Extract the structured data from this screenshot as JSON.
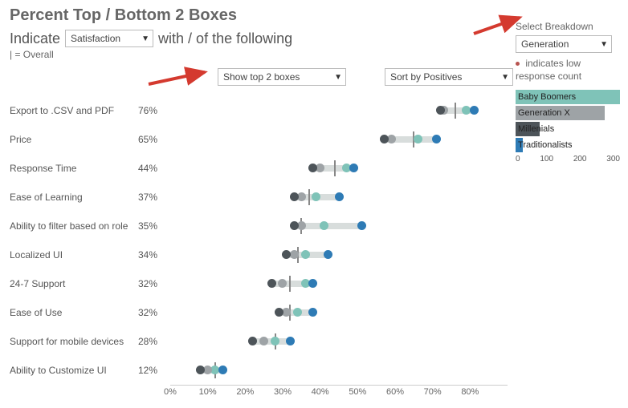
{
  "title": "Percent Top / Bottom 2 Boxes",
  "indicate": {
    "prefix": "Indicate",
    "dropdown_value": "Satisfaction",
    "suffix": "with / of the following",
    "overall_note": "| = Overall"
  },
  "controls": {
    "show_boxes": "Show top 2 boxes",
    "sort_by": "Sort by Positives"
  },
  "breakdown": {
    "label": "Select Breakdown",
    "value": "Generation"
  },
  "legend_note": {
    "prefix_symbol": "•",
    "text": "indicates low response count"
  },
  "colors": {
    "baby_boomers": "#7fc3b8",
    "generation_x": "#9ea3a6",
    "millenials": "#4d5459",
    "traditionalists": "#2e7bb5"
  },
  "mini_legend": {
    "axis": [
      "0",
      "100",
      "200",
      "300"
    ],
    "items": [
      {
        "label": "Baby Boomers",
        "color_key": "baby_boomers",
        "value": 300
      },
      {
        "label": "Generation X",
        "color_key": "generation_x",
        "value": 255
      },
      {
        "label": "Millenials",
        "color_key": "millenials",
        "value": 70
      },
      {
        "label": "Traditionalists",
        "color_key": "traditionalists",
        "value": 20
      }
    ],
    "max": 300
  },
  "chart_data": {
    "type": "dot-strip",
    "xlabel": "",
    "xlim": [
      0,
      90
    ],
    "axis_ticks": [
      "0%",
      "10%",
      "20%",
      "30%",
      "40%",
      "50%",
      "60%",
      "70%",
      "80%"
    ],
    "series": [
      {
        "name": "Baby Boomers",
        "color_key": "baby_boomers"
      },
      {
        "name": "Generation X",
        "color_key": "generation_x"
      },
      {
        "name": "Millenials",
        "color_key": "millenials"
      },
      {
        "name": "Overall (tick)",
        "color_key": "overall_tick"
      },
      {
        "name": "Traditionalists",
        "color_key": "traditionalists"
      }
    ],
    "rows": [
      {
        "category": "Export to .CSV and PDF",
        "overall": 76,
        "overall_label": "76%",
        "points": {
          "baby_boomers": 79,
          "generation_x": 73,
          "millenials": 72,
          "traditionalists": 81
        },
        "band": [
          72,
          81
        ]
      },
      {
        "category": "Price",
        "overall": 65,
        "overall_label": "65%",
        "points": {
          "baby_boomers": 66,
          "generation_x": 59,
          "millenials": 57,
          "traditionalists": 71
        },
        "band": [
          57,
          71
        ]
      },
      {
        "category": "Response Time",
        "overall": 44,
        "overall_label": "44%",
        "points": {
          "baby_boomers": 47,
          "generation_x": 40,
          "millenials": 38,
          "traditionalists": 49
        },
        "band": [
          38,
          49
        ]
      },
      {
        "category": "Ease of Learning",
        "overall": 37,
        "overall_label": "37%",
        "points": {
          "baby_boomers": 39,
          "generation_x": 35,
          "millenials": 33,
          "traditionalists": 45
        },
        "band": [
          33,
          45
        ]
      },
      {
        "category": "Ability to filter based on role",
        "overall": 35,
        "overall_label": "35%",
        "points": {
          "baby_boomers": 41,
          "generation_x": 35,
          "millenials": 33,
          "traditionalists": 51
        },
        "band": [
          33,
          51
        ]
      },
      {
        "category": "Localized UI",
        "overall": 34,
        "overall_label": "34%",
        "points": {
          "baby_boomers": 36,
          "generation_x": 33,
          "millenials": 31,
          "traditionalists": 42
        },
        "band": [
          31,
          42
        ]
      },
      {
        "category": "24-7 Support",
        "overall": 32,
        "overall_label": "32%",
        "points": {
          "baby_boomers": 36,
          "generation_x": 30,
          "millenials": 27,
          "traditionalists": 38
        },
        "band": [
          27,
          38
        ]
      },
      {
        "category": "Ease of Use",
        "overall": 32,
        "overall_label": "32%",
        "points": {
          "baby_boomers": 34,
          "generation_x": 31,
          "millenials": 29,
          "traditionalists": 38
        },
        "band": [
          29,
          38
        ]
      },
      {
        "category": "Support for mobile devices",
        "overall": 28,
        "overall_label": "28%",
        "points": {
          "baby_boomers": 28,
          "generation_x": 25,
          "millenials": 22,
          "traditionalists": 32
        },
        "band": [
          22,
          32
        ]
      },
      {
        "category": "Ability to Customize UI",
        "overall": 12,
        "overall_label": "12%",
        "points": {
          "baby_boomers": 12,
          "generation_x": 10,
          "millenials": 8,
          "traditionalists": 14
        },
        "band": [
          8,
          14
        ]
      }
    ]
  }
}
